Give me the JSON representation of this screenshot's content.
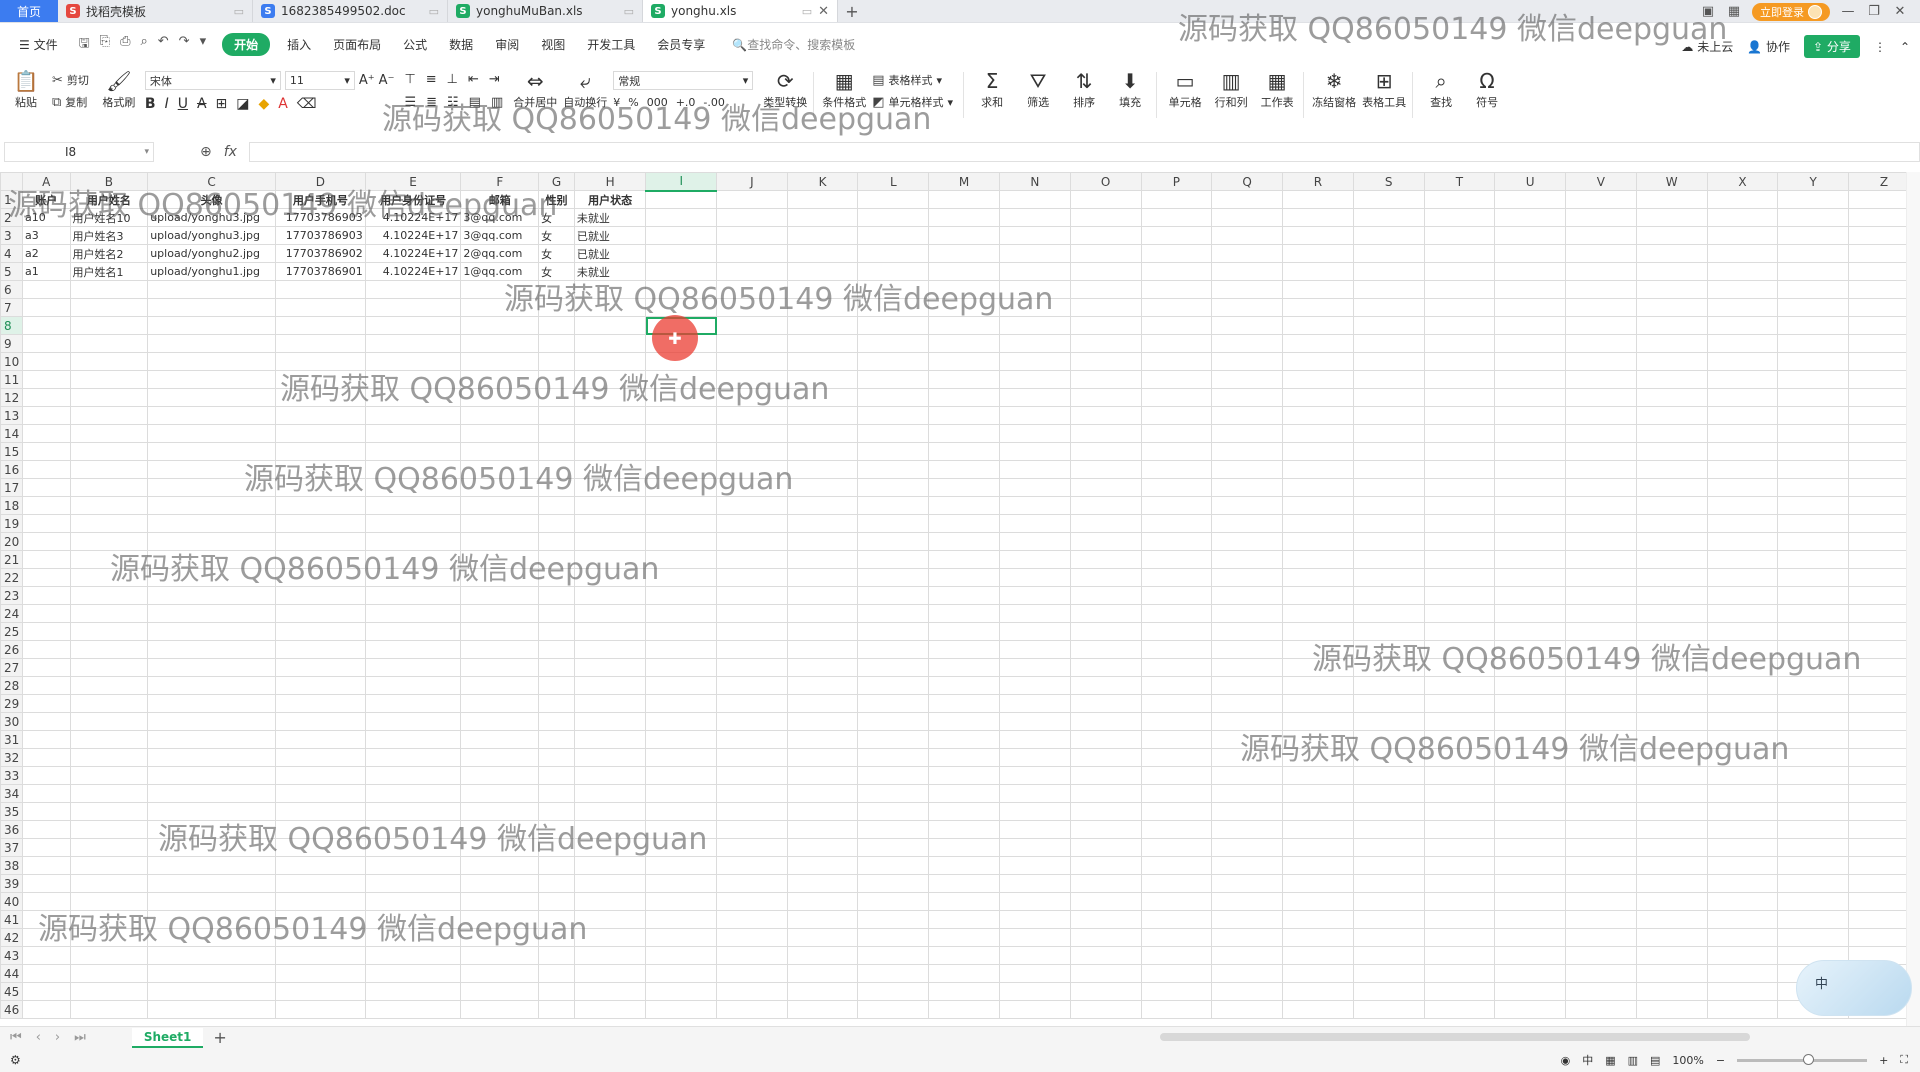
{
  "tabs": {
    "home": "首页",
    "docs": [
      {
        "name": "找稻壳模板",
        "icon": "wps-template-icon",
        "color": "#e5483f",
        "active": false
      },
      {
        "name": "1682385499502.doc",
        "icon": "word-icon",
        "color": "#3c7cf0",
        "active": false
      },
      {
        "name": "yonghuMuBan.xls",
        "icon": "spreadsheet-icon",
        "color": "#1fab64",
        "active": false
      },
      {
        "name": "yonghu.xls",
        "icon": "spreadsheet-icon",
        "color": "#1fab64",
        "active": true
      }
    ],
    "login": "立即登录"
  },
  "menu": {
    "file": "文件",
    "items": [
      "开始",
      "插入",
      "页面布局",
      "公式",
      "数据",
      "审阅",
      "视图",
      "开发工具",
      "会员专享"
    ],
    "active": "开始",
    "search": "查找命令、搜索模板",
    "cloud": "未上云",
    "collab": "协作",
    "share": "分享"
  },
  "ribbon": {
    "paste": "粘贴",
    "cut": "剪切",
    "copy": "复制",
    "format_painter": "格式刷",
    "font_name": "宋体",
    "font_size": "11",
    "number_format": "常规",
    "merge": "合并居中",
    "wrap": "自动换行",
    "type_convert": "类型转换",
    "conditional": "条件格式",
    "table_style": "表格样式",
    "cell_style": "单元格样式",
    "sum": "求和",
    "filter": "筛选",
    "sort": "排序",
    "fill": "填充",
    "cell": "单元格",
    "rowcol": "行和列",
    "worksheet": "工作表",
    "freeze": "冻结窗格",
    "table_tools": "表格工具",
    "find": "查找",
    "symbol": "符号"
  },
  "formula": {
    "cell_ref": "I8",
    "value": ""
  },
  "sheet": {
    "columns": [
      "A",
      "B",
      "C",
      "D",
      "E",
      "F",
      "G",
      "H",
      "I",
      "J",
      "K",
      "L",
      "M",
      "N",
      "O",
      "P",
      "Q",
      "R",
      "S",
      "T",
      "U",
      "V",
      "W",
      "X",
      "Y",
      "Z"
    ],
    "selected_col": "I",
    "selected_row": 8,
    "header": [
      "账户",
      "用户姓名",
      "头像",
      "用户手机号",
      "用户身份证号",
      "邮箱",
      "性别",
      "用户状态"
    ],
    "rows": [
      [
        "a10",
        "用户姓名10",
        "upload/yonghu3.jpg",
        "17703786903",
        "4.10224E+17",
        "3@qq.com",
        "女",
        "未就业"
      ],
      [
        "a3",
        "用户姓名3",
        "upload/yonghu3.jpg",
        "17703786903",
        "4.10224E+17",
        "3@qq.com",
        "女",
        "已就业"
      ],
      [
        "a2",
        "用户姓名2",
        "upload/yonghu2.jpg",
        "17703786902",
        "4.10224E+17",
        "2@qq.com",
        "女",
        "已就业"
      ],
      [
        "a1",
        "用户姓名1",
        "upload/yonghu1.jpg",
        "17703786901",
        "4.10224E+17",
        "1@qq.com",
        "女",
        "未就业"
      ]
    ],
    "total_rows": 46,
    "sheet_tab": "Sheet1"
  },
  "status": {
    "zoom": "100%",
    "ime": "中"
  },
  "watermark": "源码获取 QQ86050149 微信deepguan"
}
